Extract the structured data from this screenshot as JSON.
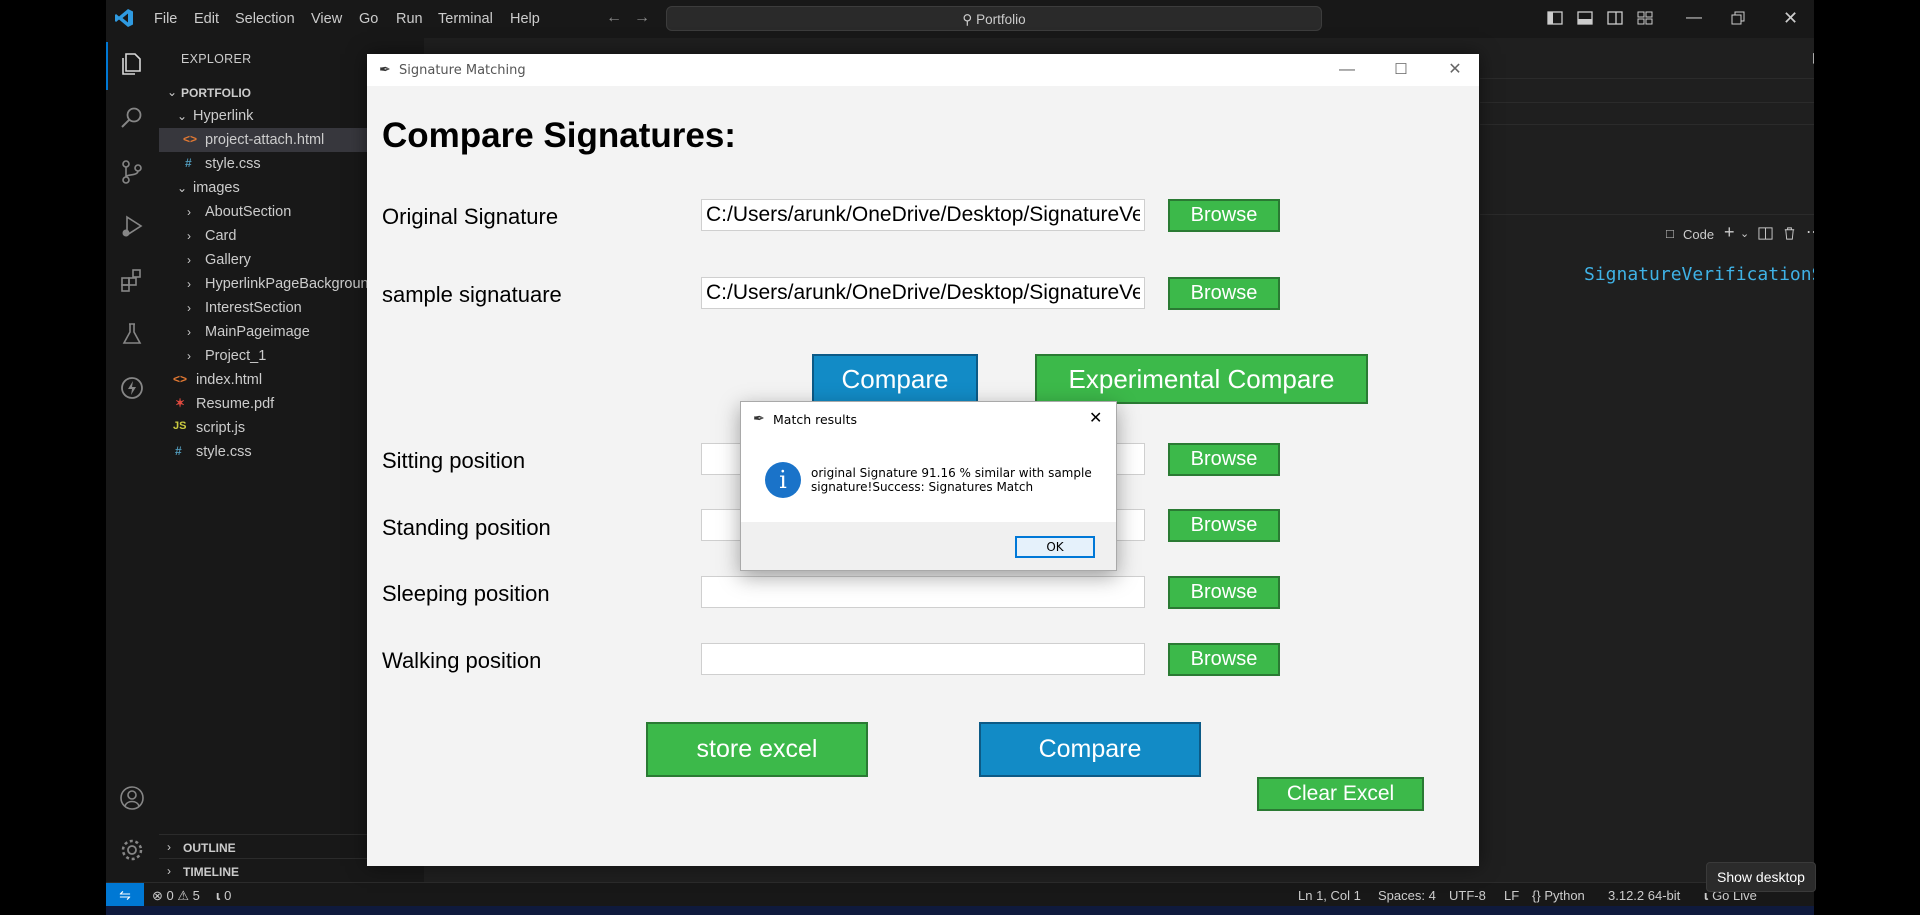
{
  "vscode": {
    "menu": [
      "File",
      "Edit",
      "Selection",
      "View",
      "Go",
      "Run",
      "Terminal",
      "Help"
    ],
    "search_label": "Portfolio",
    "explorer_title": "EXPLORER",
    "tree": [
      {
        "label": "PORTFOLIO",
        "type": "root"
      },
      {
        "label": "Hyperlink",
        "type": "folder-open"
      },
      {
        "label": "project-attach.html",
        "type": "html",
        "selected": true
      },
      {
        "label": "style.css",
        "type": "css"
      },
      {
        "label": "images",
        "type": "folder-open"
      },
      {
        "label": "AboutSection",
        "type": "folder"
      },
      {
        "label": "Card",
        "type": "folder"
      },
      {
        "label": "Gallery",
        "type": "folder"
      },
      {
        "label": "HyperlinkPageBackground",
        "type": "folder"
      },
      {
        "label": "InterestSection",
        "type": "folder"
      },
      {
        "label": "MainPageimage",
        "type": "folder"
      },
      {
        "label": "Project_1",
        "type": "folder"
      },
      {
        "label": "index.html",
        "type": "html"
      },
      {
        "label": "Resume.pdf",
        "type": "pdf"
      },
      {
        "label": "script.js",
        "type": "js"
      },
      {
        "label": "style.css",
        "type": "css"
      }
    ],
    "outline_label": "OUTLINE",
    "timeline_label": "TIMELINE",
    "panel_code_label": "Code",
    "terminal_text": "SignatureVerificationSystem",
    "status": {
      "errors": "0",
      "warnings": "5",
      "ports": "0",
      "position": "Ln 1, Col 1",
      "spaces": "Spaces: 4",
      "encoding": "UTF-8",
      "eol": "LF",
      "language": "Python",
      "interpreter": "3.12.2 64-bit",
      "golive": "Go Live"
    },
    "show_desktop": "Show desktop"
  },
  "tk": {
    "title": "Signature Matching",
    "heading": "Compare Signatures:",
    "rows": [
      {
        "label": "Original Signature",
        "value": "C:/Users/arunk/OneDrive/Desktop/SignatureVer"
      },
      {
        "label": "sample signatuare",
        "value": "C:/Users/arunk/OneDrive/Desktop/SignatureVer"
      },
      {
        "label": "Sitting position",
        "value": ""
      },
      {
        "label": "Standing position",
        "value": ""
      },
      {
        "label": "Sleeping position",
        "value": ""
      },
      {
        "label": "Walking position",
        "value": ""
      }
    ],
    "browse_label": "Browse",
    "compare_label": "Compare",
    "experimental_label": "Experimental Compare",
    "store_excel_label": "store excel",
    "compare2_label": "Compare",
    "clear_excel_label": "Clear Excel",
    "colors": {
      "green": "#3cb94a",
      "blue": "#128bc6"
    }
  },
  "dialog": {
    "title": "Match results",
    "message": "original Signature  91.16 % similar with sample signature!Success: Signatures Match",
    "ok_label": "OK"
  }
}
